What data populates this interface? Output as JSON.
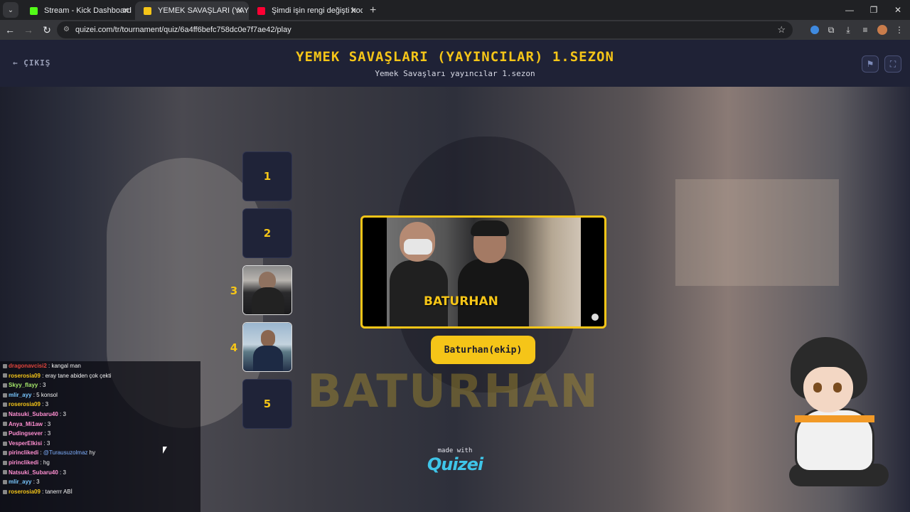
{
  "browser": {
    "tabs": [
      {
        "title": "Stream - Kick Dashboard",
        "favicon_color": "#53fc18"
      },
      {
        "title": "YEMEK SAVAŞLARI (YAYINCILAR",
        "favicon_color": "#f5c518"
      },
      {
        "title": "Şimdi işin rengi değişti hocam",
        "favicon_color": "#ff0033"
      }
    ],
    "url": "quizei.com/tr/tournament/quiz/6a4ff6befc758dc0e7f7ae42/play"
  },
  "header": {
    "exit_label": "ÇIKIŞ",
    "title": "YEMEK SAVAŞLARI (YAYINCILAR) 1.SEZON",
    "subtitle": "Yemek Savaşları yayıncılar 1.sezon"
  },
  "slots": [
    {
      "number": "1",
      "filled": false
    },
    {
      "number": "2",
      "filled": false
    },
    {
      "number": "3",
      "filled": true
    },
    {
      "number": "4",
      "filled": true
    },
    {
      "number": "5",
      "filled": false
    }
  ],
  "card": {
    "overlay_text": "BATURHAN",
    "answer_label": "Baturhan(ekip)",
    "background_text": "BATURHAN"
  },
  "footer": {
    "made_with": "made with",
    "logo": "QUIZEI"
  },
  "chat": [
    {
      "user": "dragonavcisi2",
      "message": "kangal man",
      "color": "#e2453c"
    },
    {
      "user": "roserosia09",
      "message": "eray tane abiden çok çekti",
      "color": "#f5c518"
    },
    {
      "user": "Skyy_flayy",
      "message": "3",
      "color": "#a6e86a"
    },
    {
      "user": "mlir_ayy",
      "message": "5 konsol",
      "color": "#79c7ff"
    },
    {
      "user": "roserosia09",
      "message": "3",
      "color": "#f5c518"
    },
    {
      "user": "Natsuki_Subaru40",
      "message": "3",
      "color": "#ff8fd1"
    },
    {
      "user": "Anya_Mi1aw",
      "message": "3",
      "color": "#ff8fd1"
    },
    {
      "user": "Pudingsever",
      "message": "3",
      "color": "#ff8fd1"
    },
    {
      "user": "VesperElkisi",
      "message": "3",
      "color": "#ff8fd1"
    },
    {
      "user": "pirinclikedi",
      "message": "@Turausuzolmaz hy",
      "color": "#ff8fd1",
      "mention": "@Turausuzolmaz"
    },
    {
      "user": "pirinclikedi",
      "message": "hg",
      "color": "#ff8fd1"
    },
    {
      "user": "Natsuki_Subaru40",
      "message": "3",
      "color": "#ff8fd1"
    },
    {
      "user": "mlir_ayy",
      "message": "3",
      "color": "#79c7ff"
    },
    {
      "user": "roserosia09",
      "message": "tanerrr ABİ",
      "color": "#f5c518"
    }
  ],
  "colors": {
    "accent": "#f5c518",
    "header_bg": "#1f2236",
    "logo": "#3fc5e8"
  }
}
